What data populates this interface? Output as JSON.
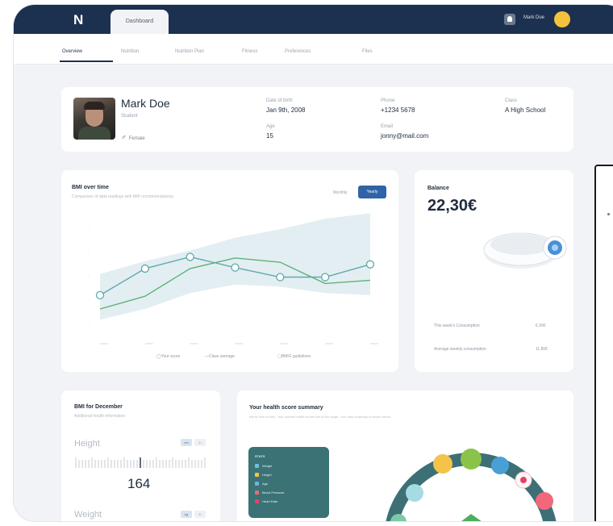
{
  "topbar": {
    "logo": "N",
    "active_tab": "Dashboard",
    "user_name": "Mark Doe"
  },
  "subnav": {
    "items": [
      "Overview",
      "Nutrition",
      "Nutrition Plan",
      "Fitness",
      "Preferences",
      "Files"
    ]
  },
  "profile": {
    "name": "Mark Doe",
    "role": "Student",
    "gender": "Female",
    "dob_label": "Date of birth",
    "dob": "Jan 9th, 2008",
    "age_label": "Age",
    "age": "15",
    "phone_label": "Phone",
    "phone": "+1234 5678",
    "email_label": "Email",
    "email": "jonny@mail.com",
    "class_label": "Class",
    "class": "A High School"
  },
  "bmi_chart": {
    "title": "BMI over time",
    "subtitle": "Comparison of data readings with BMI recommendations",
    "toggle_secondary": "Monthly",
    "toggle_primary": "Yearly",
    "legend": [
      "Your score",
      "Class average",
      "BMIG guidelines"
    ]
  },
  "chart_data": {
    "type": "line",
    "title": "BMI over time",
    "categories": [
      "",
      "",
      "",
      "",
      "",
      "",
      ""
    ],
    "ylim": [
      0,
      110
    ],
    "series": [
      {
        "name": "Your score",
        "values": [
          38,
          63,
          74,
          64,
          55,
          55,
          67
        ]
      },
      {
        "name": "Class average",
        "values": [
          25,
          37,
          63,
          73,
          69,
          49,
          52
        ]
      }
    ],
    "band_lower": [
      15,
      25,
      40,
      48,
      46,
      40,
      38
    ],
    "band_upper": [
      58,
      70,
      80,
      92,
      100,
      110,
      115
    ],
    "colors": {
      "score": "#5fa9ad",
      "average": "#5fb27a",
      "band": "#e3eef2"
    }
  },
  "balance": {
    "label": "Balance",
    "value": "22,30€",
    "rows": [
      {
        "label": "This week's Consumption",
        "value": "6.30€"
      },
      {
        "label": "Average weekly consumption",
        "value": "11.80€"
      }
    ]
  },
  "bmi_december": {
    "title": "BMI for December",
    "subtitle": "Additional health information",
    "height_label": "Height",
    "height_units": [
      "cm",
      "in"
    ],
    "height_value": "164",
    "weight_label": "Weight",
    "weight_units": [
      "kg",
      "lb"
    ]
  },
  "health_summary": {
    "title": "Your health score summary",
    "subtitle": "We're here to help. Your current health scores are in the range. Your data summary is shown below.",
    "stats_header": "STATS",
    "stats": [
      {
        "label": "Weight",
        "color": "#6cc0e0"
      },
      {
        "label": "Height",
        "color": "#f3c34a"
      },
      {
        "label": "Age",
        "color": "#6fb3de"
      },
      {
        "label": "Blood Pressure",
        "color": "#f2677a"
      },
      {
        "label": "Heart Rate",
        "color": "#e6416a"
      }
    ]
  }
}
